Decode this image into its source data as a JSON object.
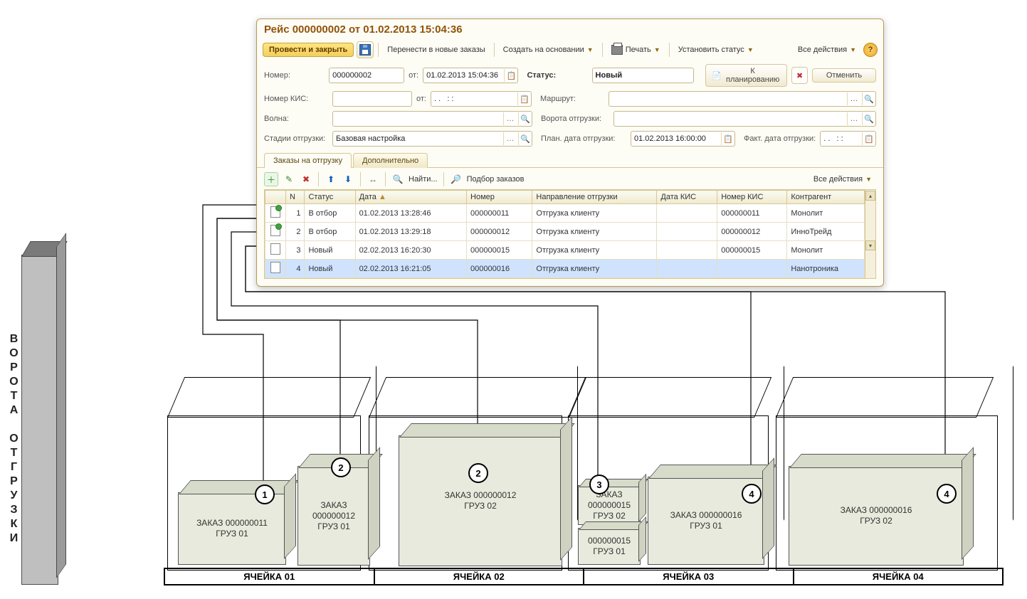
{
  "window": {
    "title": "Рейс 000000002 от 01.02.2013 15:04:36"
  },
  "toolbar": {
    "post_close": "Провести и закрыть",
    "move_to_new": "Перенести в новые заказы",
    "create_based": "Создать на основании",
    "print": "Печать",
    "set_status": "Установить статус",
    "all_actions": "Все действия"
  },
  "labels": {
    "number": "Номер:",
    "from": "от:",
    "status": "Статус:",
    "to_planning": "К планированию",
    "cancel": "Отменить",
    "kis_number": "Номер КИС:",
    "route": "Маршрут:",
    "wave": "Волна:",
    "ship_gate": "Ворота отгрузки:",
    "ship_stages": "Стадии отгрузки:",
    "plan_date": "План. дата отгрузки:",
    "fact_date": "Факт. дата отгрузки:",
    "date_placeholder": ". .   : :"
  },
  "values": {
    "number": "000000002",
    "from_dt": "01.02.2013 15:04:36",
    "status": "Новый",
    "kis_number": "",
    "kis_from": ". .   : :",
    "route": "",
    "wave": "",
    "ship_gate": "",
    "ship_stages": "Базовая настройка",
    "plan_date": "01.02.2013 16:00:00",
    "fact_date": ". .   : :"
  },
  "tabs": {
    "orders": "Заказы на отгрузку",
    "extra": "Дополнительно"
  },
  "grid_toolbar": {
    "find": "Найти...",
    "pick": "Подбор заказов",
    "all_actions": "Все действия"
  },
  "grid": {
    "columns": [
      "N",
      "Статус",
      "Дата",
      "Номер",
      "Направление отгрузки",
      "Дата КИС",
      "Номер КИС",
      "Контрагент"
    ],
    "rows": [
      {
        "state": "posted",
        "n": 1,
        "status": "В отбор",
        "date": "01.02.2013 13:28:46",
        "num": "000000011",
        "dir": "Отгрузка клиенту",
        "kis_date": "",
        "kis_num": "000000011",
        "agent": "Монолит",
        "selected": false
      },
      {
        "state": "posted",
        "n": 2,
        "status": "В отбор",
        "date": "01.02.2013 13:29:18",
        "num": "000000012",
        "dir": "Отгрузка клиенту",
        "kis_date": "",
        "kis_num": "000000012",
        "agent": "ИнноТрейд",
        "selected": false
      },
      {
        "state": "new",
        "n": 3,
        "status": "Новый",
        "date": "02.02.2013 16:20:30",
        "num": "000000015",
        "dir": "Отгрузка клиенту",
        "kis_date": "",
        "kis_num": "000000015",
        "agent": "Монолит",
        "selected": false
      },
      {
        "state": "new",
        "n": 4,
        "status": "Новый",
        "date": "02.02.2013 16:21:05",
        "num": "000000016",
        "dir": "Отгрузка клиенту",
        "kis_date": "",
        "kis_num": "",
        "agent": "Нанотроника",
        "selected": true
      }
    ]
  },
  "diagram": {
    "gate_label": "ВОРОТА ОТГРУЗКИ",
    "cells": [
      "ЯЧЕЙКА 01",
      "ЯЧЕЙКА 02",
      "ЯЧЕЙКА 03",
      "ЯЧЕЙКА 04"
    ],
    "boxes": [
      {
        "order": "ЗАКАЗ 000000011",
        "cargo": "ГРУЗ 01",
        "badge": "1"
      },
      {
        "order": "ЗАКАЗ",
        "order2": "000000012",
        "cargo": "ГРУЗ 01",
        "badge": "2"
      },
      {
        "order": "ЗАКАЗ 000000012",
        "cargo": "ГРУЗ 02",
        "badge": "2"
      },
      {
        "order": "ЗАКАЗ",
        "order2": "000000015",
        "cargo": "ГРУЗ 02",
        "badge": "3"
      },
      {
        "order2": "000000015",
        "cargo": "ГРУЗ 01"
      },
      {
        "order": "ЗАКАЗ 000000016",
        "cargo": "ГРУЗ 01",
        "badge": "4"
      },
      {
        "order": "ЗАКАЗ 000000016",
        "cargo": "ГРУЗ 02",
        "badge": "4"
      }
    ]
  }
}
